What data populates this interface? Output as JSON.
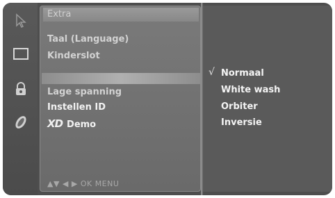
{
  "menu": {
    "title": "Extra",
    "items": [
      {
        "label": "Taal (Language)"
      },
      {
        "label": "Kinderslot"
      },
      {
        "label": ""
      },
      {
        "label": "Lage spanning"
      },
      {
        "label": "Instellen ID"
      },
      {
        "label": "Demo",
        "logo": "XD"
      }
    ],
    "nav_hint": "▲▼  ◀ ▶  OK  MENU"
  },
  "submenu": {
    "items": [
      {
        "label": "Normaal",
        "checked": true
      },
      {
        "label": "White wash",
        "checked": false
      },
      {
        "label": "Orbiter",
        "checked": false
      },
      {
        "label": "Inversie",
        "checked": false
      }
    ],
    "check_symbol": "√"
  },
  "icons": [
    "cursor-icon",
    "screen-icon",
    "lock-icon",
    "option-icon"
  ]
}
